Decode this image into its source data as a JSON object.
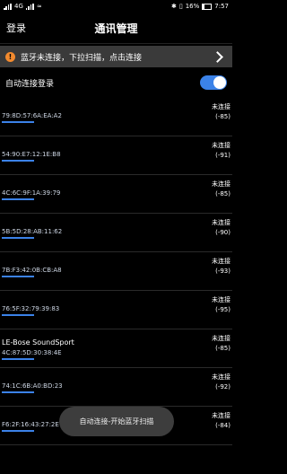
{
  "status_bar": {
    "left": "4G",
    "battery": "16%",
    "time": "7:57"
  },
  "header": {
    "login_label": "登录",
    "title": "通讯管理"
  },
  "banner": {
    "text": "蓝牙未连接，下拉扫描，点击连接"
  },
  "auto_connect": {
    "label": "自动连接登录",
    "enabled": true
  },
  "devices": [
    {
      "name": "",
      "mac": "79:8D:57:6A:EA:A2",
      "status": "未连接",
      "rssi": "(-85)"
    },
    {
      "name": "",
      "mac": "54:90:E7:12:1E:B8",
      "status": "未连接",
      "rssi": "(-91)"
    },
    {
      "name": "",
      "mac": "4C:6C:9F:1A:39:79",
      "status": "未连接",
      "rssi": "(-85)"
    },
    {
      "name": "",
      "mac": "5B:5D:28:AB:11:62",
      "status": "未连接",
      "rssi": "(-90)"
    },
    {
      "name": "",
      "mac": "7B:F3:42:0B:CB:A8",
      "status": "未连接",
      "rssi": "(-93)"
    },
    {
      "name": "",
      "mac": "76:5F:32:79:39:83",
      "status": "未连接",
      "rssi": "(-95)"
    },
    {
      "name": "LE-Bose SoundSport",
      "mac": "4C:87:5D:30:38:4E",
      "status": "未连接",
      "rssi": "(-85)"
    },
    {
      "name": "",
      "mac": "74:1C:6B:A0:BD:23",
      "status": "未连接",
      "rssi": "(-92)"
    },
    {
      "name": "",
      "mac": "F6:2F:16:43:27:2E",
      "status": "未连接",
      "rssi": "(-84)"
    }
  ],
  "toast": {
    "text": "自动连接-开始蓝牙扫描"
  }
}
